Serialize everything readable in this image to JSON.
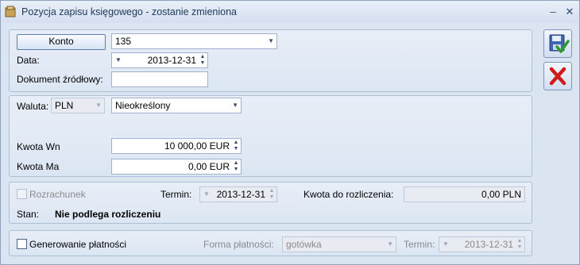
{
  "window": {
    "title": "Pozycja zapisu księgowego - zostanie zmieniona"
  },
  "konto": {
    "button_label": "Konto",
    "value": "135"
  },
  "data": {
    "label": "Data:",
    "value": "2013-12-31"
  },
  "dokument": {
    "label": "Dokument źródłowy:",
    "value": ""
  },
  "waluta": {
    "label": "Waluta:",
    "currency": "PLN",
    "rate_type": "Nieokreślony",
    "kwota_wn_label": "Kwota Wn",
    "kwota_wn_value": "10 000,00 EUR",
    "kwota_ma_label": "Kwota Ma",
    "kwota_ma_value": "0,00 EUR"
  },
  "rozrachunek": {
    "checkbox_label": "Rozrachunek",
    "termin_label": "Termin:",
    "termin_value": "2013-12-31",
    "kwota_label": "Kwota do rozliczenia:",
    "kwota_value": "0,00 PLN",
    "stan_label": "Stan:",
    "stan_value": "Nie podlega rozliczeniu"
  },
  "platnosc": {
    "checkbox_label": "Generowanie płatności",
    "forma_label": "Forma płatności:",
    "forma_value": "gotówka",
    "termin_label": "Termin:",
    "termin_value": "2013-12-31"
  },
  "icons": {
    "save": "save-check-icon",
    "cancel": "red-x-icon"
  }
}
